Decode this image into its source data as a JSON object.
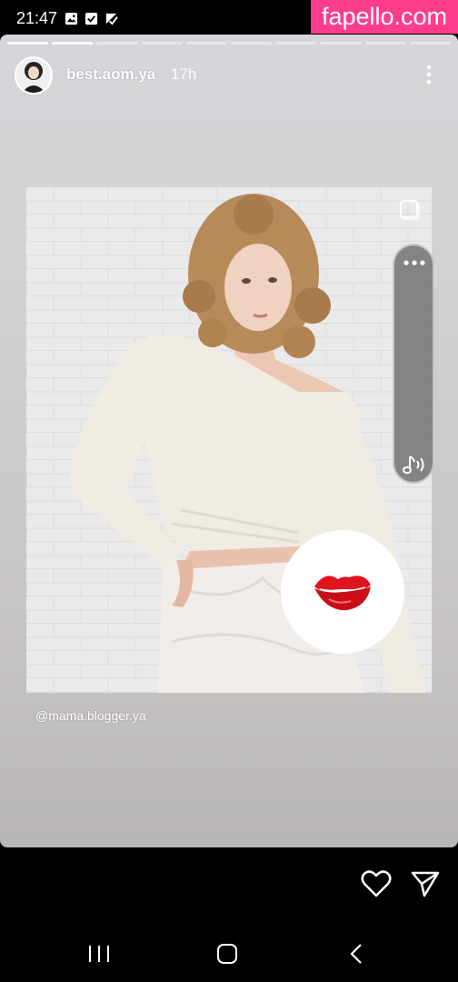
{
  "status_bar": {
    "time": "21:47",
    "icons": [
      "gallery-icon",
      "check-icon",
      "download-check-icon"
    ]
  },
  "watermark": {
    "text": "fapello.com",
    "color": "#ff3d8c"
  },
  "story": {
    "progress": {
      "segments": 10,
      "completed": 2
    },
    "username": "best.aom.ya",
    "timestamp": "17h",
    "mention": "@mama.blogger.ya",
    "sticker": "kiss-lips-icon",
    "music_icon": "music-note-icon"
  },
  "reply_bar": {
    "icons": [
      "heart-icon",
      "send-icon"
    ]
  },
  "nav_bar": {
    "icons": [
      "recents-icon",
      "home-icon",
      "back-icon"
    ]
  },
  "colors": {
    "accent": "#ff3d8c",
    "lips": "#e0141e"
  }
}
